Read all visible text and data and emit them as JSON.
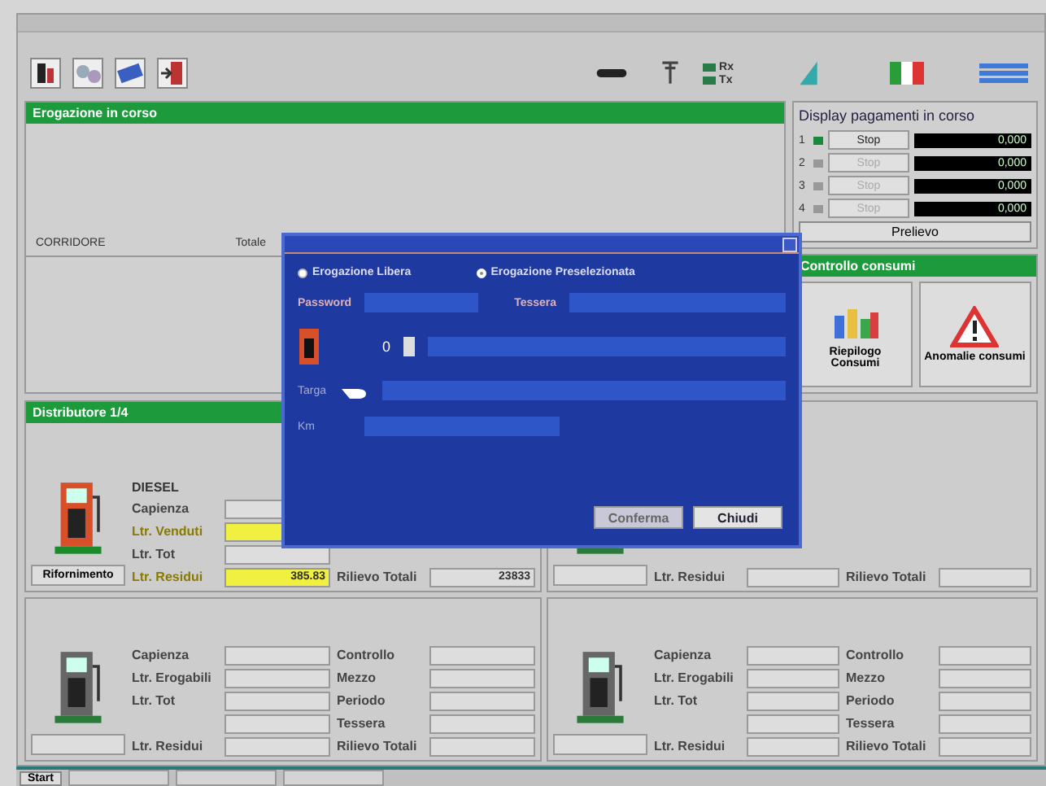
{
  "toolbar": {
    "indicators": [
      "Rx",
      "Tx"
    ]
  },
  "dispensing": {
    "header": "Erogazione in corso",
    "columns": [
      "CORRIDORE",
      "Totale"
    ]
  },
  "payments": {
    "title": "Display pagamenti in corso",
    "rows": [
      {
        "index": "1",
        "active": true,
        "button": "Stop",
        "disabled": false,
        "reading": "0,000"
      },
      {
        "index": "2",
        "active": false,
        "button": "Stop",
        "disabled": true,
        "reading": "0,000"
      },
      {
        "index": "3",
        "active": false,
        "button": "Stop",
        "disabled": true,
        "reading": "0,000"
      },
      {
        "index": "4",
        "active": false,
        "button": "Stop",
        "disabled": true,
        "reading": "0,000"
      }
    ],
    "action": "Prelievo"
  },
  "consumption": {
    "header": "Controllo consumi",
    "buttons": [
      {
        "kind": "chart",
        "label": "Riepilogo Consumi"
      },
      {
        "kind": "warning",
        "label": "Anomalie consumi"
      }
    ]
  },
  "distributors": [
    {
      "header": "Distributore 1/4",
      "product": "DIESEL",
      "button": "Rifornimento",
      "active": true,
      "rows": [
        {
          "label": "Capienza",
          "highlight": false
        },
        {
          "label": "Ltr. Venduti",
          "highlight": true
        },
        {
          "label": "Ltr. Tot",
          "highlight": false
        },
        {
          "label": "Ltr. Residui",
          "value": "385.83",
          "highlight": true
        }
      ],
      "side_rows": [
        {
          "label": "Rilievo Totali",
          "value": "23833"
        }
      ]
    },
    {
      "active": false,
      "rows": [
        {
          "label": "Ltr. Residui",
          "highlight": false
        }
      ],
      "side_rows": [
        {
          "label": "Rilievo Totali"
        }
      ]
    },
    {
      "active": false,
      "rows": [
        {
          "label": "Capienza",
          "highlight": false
        },
        {
          "label": "Ltr. Erogabili",
          "highlight": false
        },
        {
          "label": "Ltr. Tot",
          "highlight": false
        },
        {
          "highlight": false
        },
        {
          "label": "Ltr. Residui",
          "highlight": false
        }
      ],
      "side_rows": [
        {
          "label": "Controllo"
        },
        {
          "label": "Mezzo"
        },
        {
          "label": "Periodo"
        },
        {
          "label": "Tessera"
        },
        {
          "label": "Rilievo Totali"
        }
      ]
    },
    {
      "active": false,
      "rows": [
        {
          "label": "Capienza",
          "highlight": false
        },
        {
          "label": "Ltr. Erogabili",
          "highlight": false
        },
        {
          "label": "Ltr. Tot",
          "highlight": false
        },
        {
          "highlight": false
        },
        {
          "label": "Ltr. Residui",
          "highlight": false
        }
      ],
      "side_rows": [
        {
          "label": "Controllo"
        },
        {
          "label": "Mezzo"
        },
        {
          "label": "Periodo"
        },
        {
          "label": "Tessera"
        },
        {
          "label": "Rilievo Totali"
        }
      ]
    }
  ],
  "dialog": {
    "modes": [
      {
        "label": "Erogazione Libera",
        "selected": false
      },
      {
        "label": "Erogazione Preselezionata",
        "selected": true
      }
    ],
    "password_label": "Password",
    "card_label": "Tessera",
    "quantity": "0",
    "plate_label": "Targa",
    "km_label": "Km",
    "buttons": [
      {
        "label": "Conferma",
        "disabled": true
      },
      {
        "label": "Chiudi",
        "disabled": false
      }
    ]
  },
  "taskbar": {
    "start": "Start"
  }
}
